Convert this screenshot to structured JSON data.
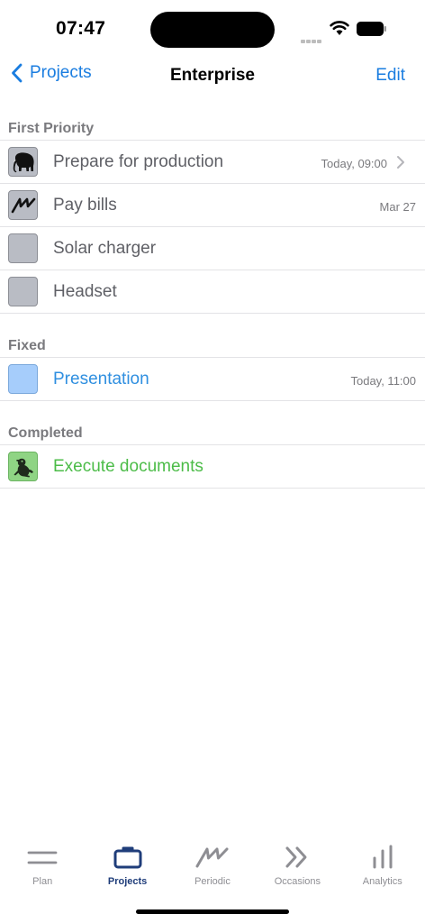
{
  "status_bar": {
    "time": "07:47"
  },
  "nav": {
    "back_label": "Projects",
    "title": "Enterprise",
    "edit_label": "Edit"
  },
  "sections": [
    {
      "title": "First Priority",
      "items": [
        {
          "label": "Prepare for production",
          "meta": "Today, 09:00",
          "icon": "elephant-icon",
          "color": "#b9bcc4",
          "chevron": true
        },
        {
          "label": "Pay bills",
          "meta": "Mar 27",
          "icon": "periodic-wave-icon",
          "color": "#b9bcc4",
          "chevron": false
        },
        {
          "label": "Solar charger",
          "meta": "",
          "icon": "gray-square-icon",
          "color": "#b9bcc4",
          "chevron": false
        },
        {
          "label": "Headset",
          "meta": "",
          "icon": "gray-square-icon",
          "color": "#b9bcc4",
          "chevron": false
        }
      ]
    },
    {
      "title": "Fixed",
      "items": [
        {
          "label": "Presentation",
          "meta": "Today, 11:00",
          "icon": "blue-square-icon",
          "color": "#a6cdfb",
          "chevron": false
        }
      ]
    },
    {
      "title": "Completed",
      "items": [
        {
          "label": "Execute documents",
          "meta": "",
          "icon": "frog-icon",
          "color": "#8fd484",
          "chevron": false
        }
      ]
    }
  ],
  "tabbar": {
    "tabs": [
      {
        "label": "Plan",
        "icon": "plan-lines-icon",
        "active": false
      },
      {
        "label": "Projects",
        "icon": "briefcase-icon",
        "active": true
      },
      {
        "label": "Periodic",
        "icon": "periodic-wave-icon",
        "active": false
      },
      {
        "label": "Occasions",
        "icon": "double-chevron-icon",
        "active": false
      },
      {
        "label": "Analytics",
        "icon": "bar-chart-icon",
        "active": false
      }
    ]
  },
  "colors": {
    "accent": "#1a7de0",
    "active_tab": "#1f3d7a",
    "fixed_text": "#2f8fe0",
    "completed_text": "#4cbc48"
  }
}
